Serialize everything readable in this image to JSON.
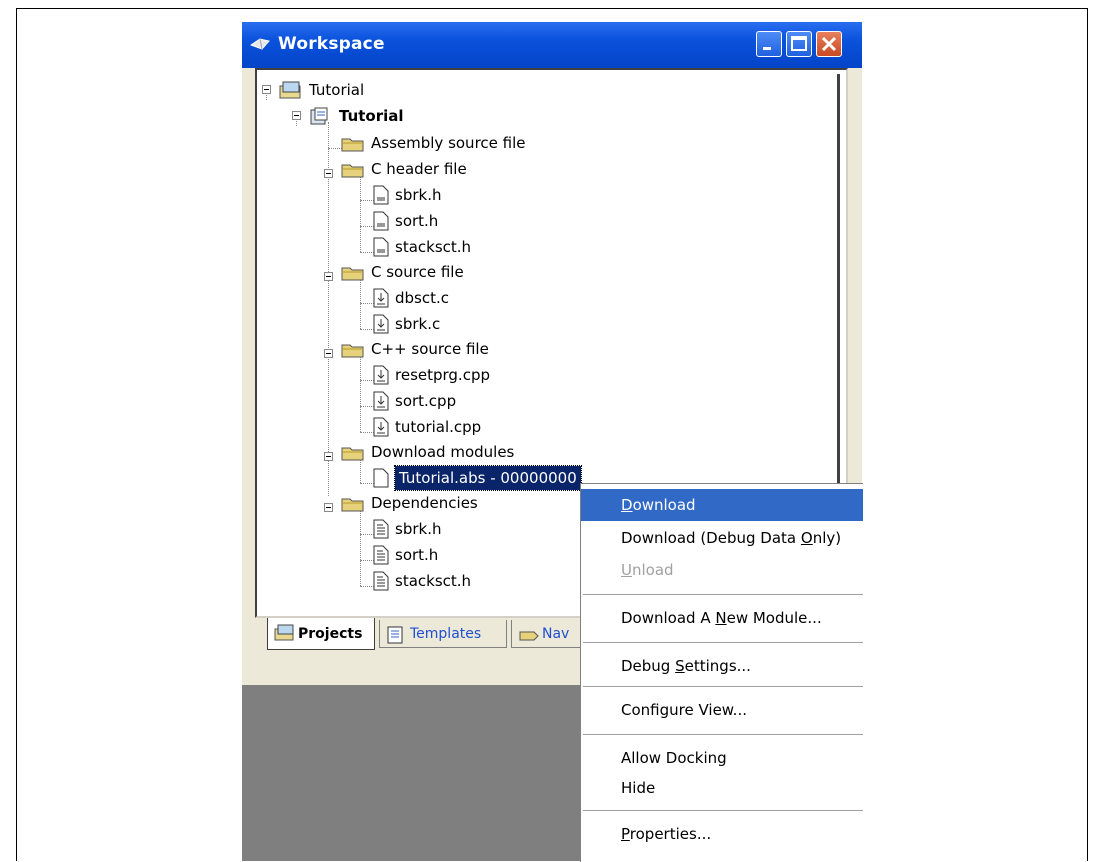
{
  "window": {
    "title": "Workspace"
  },
  "tree": {
    "root": "Tutorial",
    "project": "Tutorial",
    "folders": {
      "asm": "Assembly source file",
      "chdr": "C header file",
      "csrc": "C source file",
      "cppsrc": "C++ source file",
      "dl": "Download modules",
      "dep": "Dependencies"
    },
    "files": {
      "chdr": [
        "sbrk.h",
        "sort.h",
        "stacksct.h"
      ],
      "csrc": [
        "dbsct.c",
        "sbrk.c"
      ],
      "cppsrc": [
        "resetprg.cpp",
        "sort.cpp",
        "tutorial.cpp"
      ],
      "dl": [
        "Tutorial.abs - 00000000"
      ],
      "dep": [
        "sbrk.h",
        "sort.h",
        "stacksct.h"
      ]
    }
  },
  "tabs": {
    "projects": "Projects",
    "templates": "Templates",
    "navigation": "Nav"
  },
  "menu": {
    "download": {
      "pre": "",
      "key": "D",
      "post": "ownload"
    },
    "download_debug": {
      "pre": "Download (Debug Data ",
      "key": "O",
      "post": "nly)"
    },
    "unload": {
      "pre": "",
      "key": "U",
      "post": "nload"
    },
    "download_new": {
      "pre": "Download A ",
      "key": "N",
      "post": "ew Module..."
    },
    "debug_settings": {
      "pre": "Debug ",
      "key": "S",
      "post": "ettings..."
    },
    "configure_view": "Configure View...",
    "allow_docking": "Allow Docking",
    "hide": "Hide",
    "properties": {
      "pre": "",
      "key": "P",
      "post": "roperties..."
    }
  },
  "colors": {
    "titlebar": "#0a52dc",
    "selection": "#0a246a",
    "menu_highlight": "#3169c6",
    "disabled": "#a0a0a0"
  },
  "icons": [
    "workspace-icon",
    "minimize-icon",
    "maximize-icon",
    "close-icon",
    "workspace-tree-icon",
    "project-icon",
    "folder-icon",
    "header-file-icon",
    "source-file-icon",
    "module-file-icon",
    "dependency-file-icon",
    "templates-icon",
    "navigation-icon"
  ]
}
